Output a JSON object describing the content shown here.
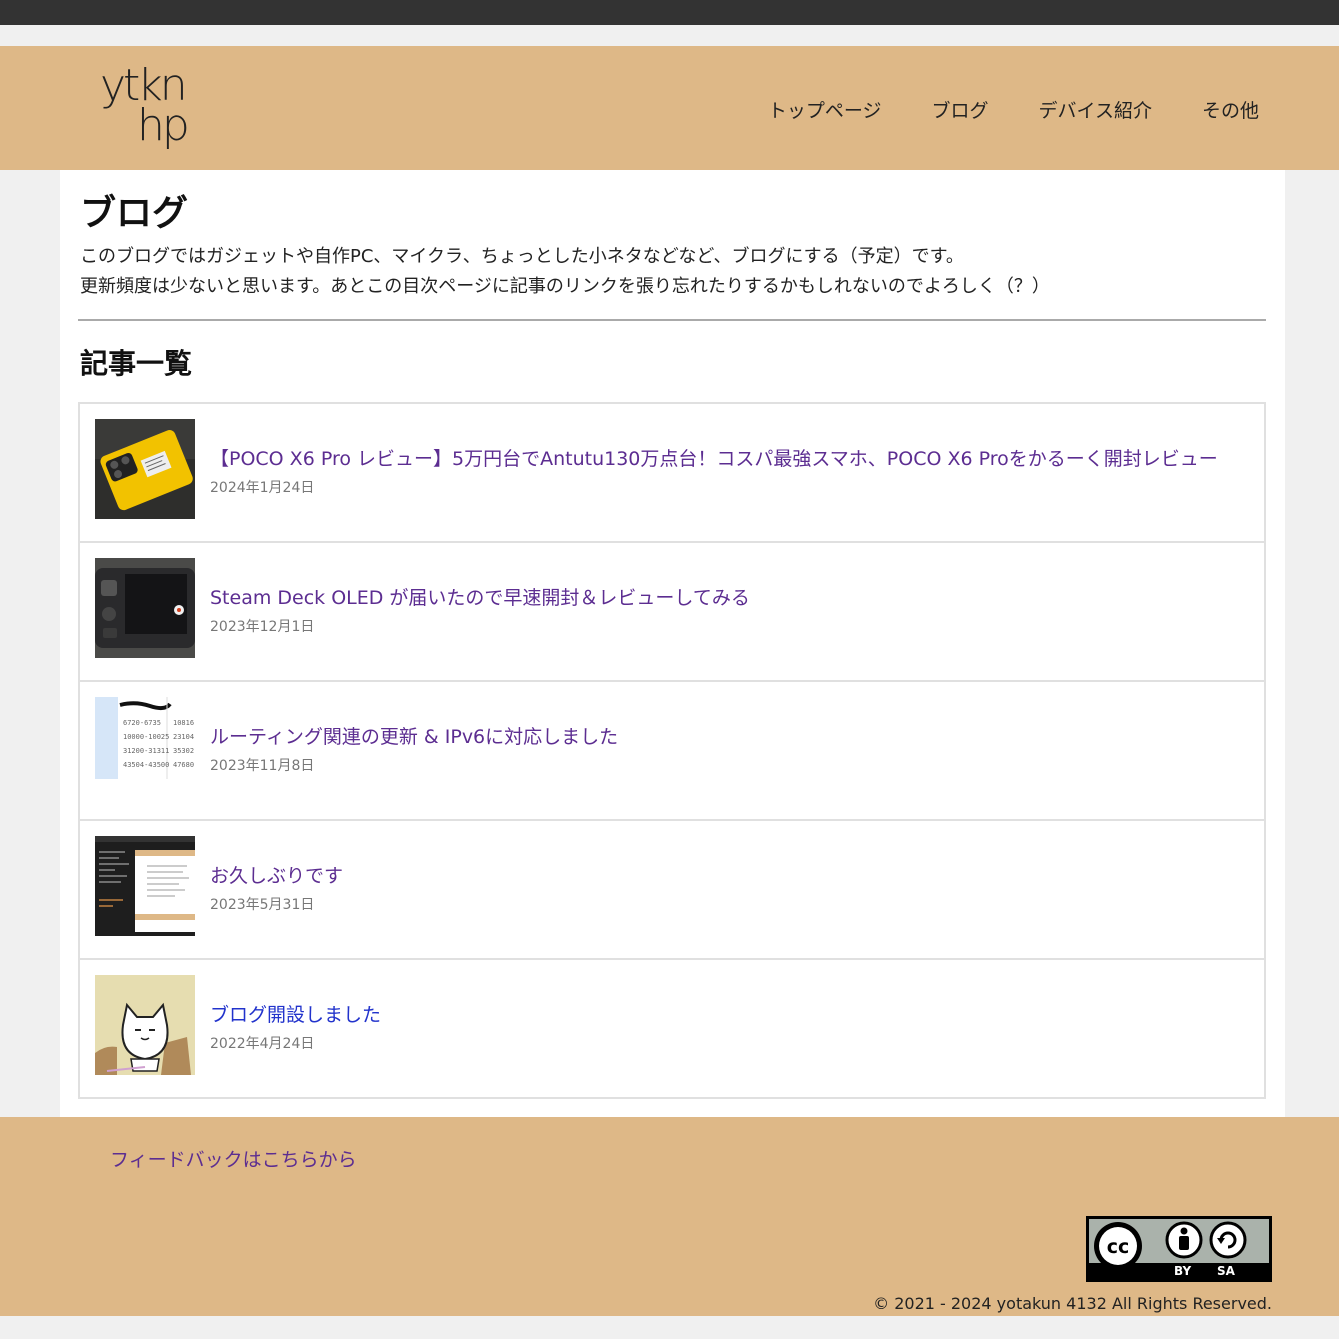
{
  "header": {
    "logo_line1": "ytkn",
    "logo_line2": "hp",
    "nav": [
      {
        "label": "トップページ"
      },
      {
        "label": "ブログ"
      },
      {
        "label": "デバイス紹介"
      },
      {
        "label": "その他"
      }
    ]
  },
  "main": {
    "title": "ブログ",
    "intro_line1": "このブログではガジェットや自作PC、マイクラ、ちょっとした小ネタなどなど、ブログにする（予定）です。",
    "intro_line2": "更新頻度は少ないと思います。あとこの目次ページに記事のリンクを張り忘れたりするかもしれないのでよろしく（？）",
    "section_title": "記事一覧",
    "articles": [
      {
        "title": "【POCO X6 Pro レビュー】5万円台でAntutu130万点台！コスパ最強スマホ、POCO X6 Proをかるーく開封レビュー",
        "date": "2024年1月24日",
        "thumb": "phone-photo-icon"
      },
      {
        "title": "Steam Deck OLED が届いたので早速開封＆レビューしてみる",
        "date": "2023年12月1日",
        "thumb": "handheld-console-photo-icon"
      },
      {
        "title": "ルーティング関連の更新 & IPv6に対応しました",
        "date": "2023年11月8日",
        "thumb": "table-screenshot-icon"
      },
      {
        "title": "お久しぶりです",
        "date": "2023年5月31日",
        "thumb": "code-editor-screenshot-icon"
      },
      {
        "title": "ブログ開設しました",
        "date": "2022年4月24日",
        "thumb": "cat-illustration-icon"
      }
    ]
  },
  "footer": {
    "feedback": "フィードバックはこちらから",
    "cc_by": "BY",
    "cc_sa": "SA",
    "copyright": "© 2021 - 2024 yotakun 4132 All Rights Reserved."
  },
  "colors": {
    "header_bg": "#deb887",
    "link_visited": "#5c2d91",
    "link": "#2233cc"
  }
}
